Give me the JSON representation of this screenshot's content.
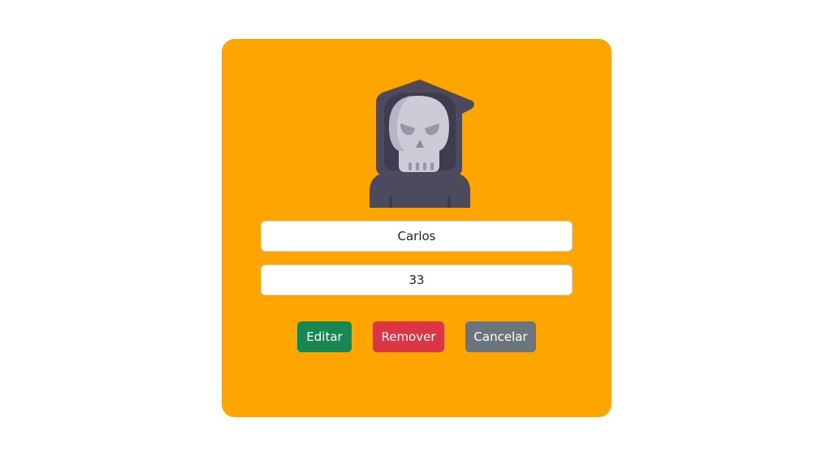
{
  "card": {
    "background_color": "#ffa500"
  },
  "avatar": {
    "icon": "grim-reaper-skull-icon"
  },
  "form": {
    "name_value": "Carlos",
    "age_value": "33"
  },
  "buttons": {
    "edit_label": "Editar",
    "edit_color": "#198754",
    "remove_label": "Remover",
    "remove_color": "#dc3545",
    "cancel_label": "Cancelar",
    "cancel_color": "#6c757d"
  }
}
